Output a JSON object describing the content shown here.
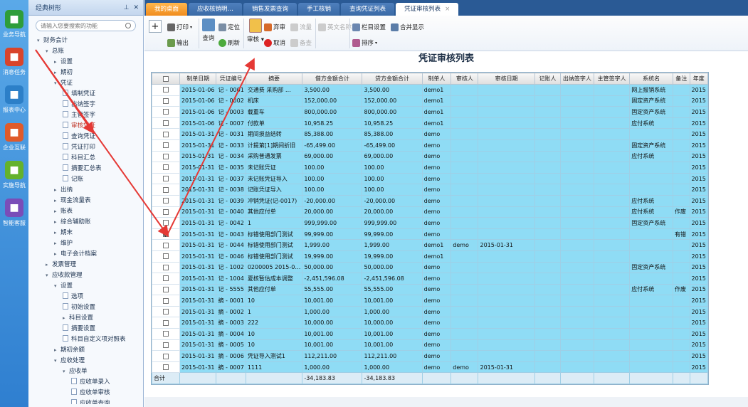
{
  "leftbar": {
    "items": [
      {
        "label": "业务导航",
        "icon": "business-nav-icon",
        "color": "#2e9d3a"
      },
      {
        "label": "消息任务",
        "icon": "message-icon",
        "color": "#d9442b"
      },
      {
        "label": "报表中心",
        "icon": "report-icon",
        "color": "#2c7fc8"
      },
      {
        "label": "企业互联",
        "icon": "enterprise-icon",
        "color": "#e05a2a"
      },
      {
        "label": "实施导航",
        "icon": "implement-icon",
        "color": "#64b22c"
      },
      {
        "label": "智能客服",
        "icon": "service-icon",
        "color": "#7a4db8"
      }
    ]
  },
  "nav": {
    "title": "经典树形",
    "search_placeholder": "请输入您要搜索的功能",
    "tree": [
      {
        "label": "财务会计",
        "level": 0,
        "arrow": "▾"
      },
      {
        "label": "总账",
        "level": 1,
        "arrow": "▾"
      },
      {
        "label": "设置",
        "level": 2,
        "arrow": "▸"
      },
      {
        "label": "期初",
        "level": 2,
        "arrow": "▸"
      },
      {
        "label": "凭证",
        "level": 2,
        "arrow": "▾"
      },
      {
        "label": "填制凭证",
        "level": 3,
        "doc": true
      },
      {
        "label": "出纳签字",
        "level": 3,
        "doc": true
      },
      {
        "label": "主管签字",
        "level": 3,
        "doc": true
      },
      {
        "label": "审核凭证",
        "level": 3,
        "doc": true,
        "selected": true
      },
      {
        "label": "查询凭证",
        "level": 3,
        "doc": true
      },
      {
        "label": "凭证打印",
        "level": 3,
        "doc": true
      },
      {
        "label": "科目汇总",
        "level": 3,
        "doc": true
      },
      {
        "label": "摘要汇总表",
        "level": 3,
        "doc": true
      },
      {
        "label": "记账",
        "level": 3,
        "doc": true
      },
      {
        "label": "出纳",
        "level": 2,
        "arrow": "▸"
      },
      {
        "label": "现金流量表",
        "level": 2,
        "arrow": "▸"
      },
      {
        "label": "账表",
        "level": 2,
        "arrow": "▸"
      },
      {
        "label": "综合辅助账",
        "level": 2,
        "arrow": "▸"
      },
      {
        "label": "期末",
        "level": 2,
        "arrow": "▸"
      },
      {
        "label": "维护",
        "level": 2,
        "arrow": "▸"
      },
      {
        "label": "电子会计档案",
        "level": 2,
        "arrow": "▸"
      },
      {
        "label": "发票管理",
        "level": 1,
        "arrow": "▸"
      },
      {
        "label": "应收款管理",
        "level": 1,
        "arrow": "▾"
      },
      {
        "label": "设置",
        "level": 2,
        "arrow": "▾"
      },
      {
        "label": "选项",
        "level": 3,
        "doc": true
      },
      {
        "label": "初始设置",
        "level": 3,
        "doc": true
      },
      {
        "label": "科目设置",
        "level": 3,
        "arrow": "▸"
      },
      {
        "label": "摘要设置",
        "level": 3,
        "doc": true
      },
      {
        "label": "科目自定义项对照表",
        "level": 3,
        "doc": true
      },
      {
        "label": "期初余额",
        "level": 2,
        "arrow": "▸"
      },
      {
        "label": "应收处理",
        "level": 2,
        "arrow": "▾"
      },
      {
        "label": "应收单",
        "level": 3,
        "arrow": "▾"
      },
      {
        "label": "应收单录入",
        "level": 4,
        "doc": true
      },
      {
        "label": "应收单审核",
        "level": 4,
        "doc": true
      },
      {
        "label": "应收单查询",
        "level": 4,
        "doc": true
      }
    ]
  },
  "tabs": [
    {
      "label": "我的桌面",
      "type": "home"
    },
    {
      "label": "应收核销明…",
      "type": "normal"
    },
    {
      "label": "销售发票查询",
      "type": "normal"
    },
    {
      "label": "手工核销",
      "type": "normal"
    },
    {
      "label": "查询凭证列表",
      "type": "normal"
    },
    {
      "label": "凭证审核列表",
      "type": "active",
      "close": "×"
    }
  ],
  "toolbar": {
    "add": "+",
    "print": "打印",
    "export": "输出",
    "query": "查询",
    "locate": "定位",
    "refresh": "刷新",
    "audit": "审核",
    "abandon": "弃审",
    "cancel": "取消",
    "flow": "流量",
    "check": "备查",
    "en_name": "英文名称",
    "column_settings": "栏目设置",
    "sort": "排序",
    "merge_display": "合并显示"
  },
  "page_title": "凭证审核列表",
  "grid": {
    "columns": [
      "制单日期",
      "凭证编号",
      "摘要",
      "借方金额合计",
      "贷方金额合计",
      "制单人",
      "审核人",
      "审核日期",
      "记账人",
      "出纳签字人",
      "主管签字人",
      "系统名",
      "备注",
      "年度"
    ],
    "rows": [
      {
        "checked": false,
        "cells": [
          "2015-01-06",
          "记 - 0001",
          "交通费 采购部 …",
          "3,500.00",
          "3,500.00",
          "demo1",
          "",
          "",
          "",
          "",
          "",
          "网上报销系统",
          "",
          "2015"
        ]
      },
      {
        "checked": false,
        "cells": [
          "2015-01-06",
          "记 - 0002",
          "机床",
          "152,000.00",
          "152,000.00",
          "demo1",
          "",
          "",
          "",
          "",
          "",
          "固定资产系统",
          "",
          "2015"
        ]
      },
      {
        "checked": false,
        "cells": [
          "2015-01-06",
          "记 - 0003",
          "载重车",
          "800,000.00",
          "800,000.00",
          "demo1",
          "",
          "",
          "",
          "",
          "",
          "固定资产系统",
          "",
          "2015"
        ]
      },
      {
        "checked": false,
        "cells": [
          "2015-01-06",
          "记 - 0007",
          "付款单",
          "10,958.25",
          "10,958.25",
          "demo1",
          "",
          "",
          "",
          "",
          "",
          "应付系统",
          "",
          "2015"
        ]
      },
      {
        "checked": false,
        "cells": [
          "2015-01-31",
          "记 - 0031",
          "期间损益结转",
          "85,388.00",
          "85,388.00",
          "demo",
          "",
          "",
          "",
          "",
          "",
          "",
          "",
          "2015"
        ]
      },
      {
        "checked": false,
        "cells": [
          "2015-01-31",
          "记 - 0033",
          "计提第[1]期间折旧",
          "-65,499.00",
          "-65,499.00",
          "demo",
          "",
          "",
          "",
          "",
          "",
          "固定资产系统",
          "",
          "2015"
        ]
      },
      {
        "checked": false,
        "cells": [
          "2015-01-31",
          "记 - 0034",
          "采购普通发票",
          "69,000.00",
          "69,000.00",
          "demo",
          "",
          "",
          "",
          "",
          "",
          "应付系统",
          "",
          "2015"
        ]
      },
      {
        "checked": false,
        "cells": [
          "2015-01-31",
          "记 - 0035",
          "未记账凭证",
          "100.00",
          "100.00",
          "demo",
          "",
          "",
          "",
          "",
          "",
          "",
          "",
          "2015"
        ]
      },
      {
        "checked": false,
        "cells": [
          "2015-01-31",
          "记 - 0037",
          "未记账凭证导入",
          "100.00",
          "100.00",
          "demo",
          "",
          "",
          "",
          "",
          "",
          "",
          "",
          "2015"
        ]
      },
      {
        "checked": false,
        "cells": [
          "2015-01-31",
          "记 - 0038",
          "记账凭证导入",
          "100.00",
          "100.00",
          "demo",
          "",
          "",
          "",
          "",
          "",
          "",
          "",
          "2015"
        ]
      },
      {
        "checked": false,
        "cells": [
          "2015-01-31",
          "记 - 0039",
          "冲销凭证(记-0017)",
          "-20,000.00",
          "-20,000.00",
          "demo",
          "",
          "",
          "",
          "",
          "",
          "应付系统",
          "",
          "2015"
        ]
      },
      {
        "checked": false,
        "cells": [
          "2015-01-31",
          "记 - 0040",
          "其他应付单",
          "20,000.00",
          "20,000.00",
          "demo",
          "",
          "",
          "",
          "",
          "",
          "应付系统",
          "作废",
          "2015"
        ]
      },
      {
        "checked": false,
        "cells": [
          "2015-01-31",
          "记 - 0042",
          "1",
          "999,999.00",
          "999,999.00",
          "demo",
          "",
          "",
          "",
          "",
          "",
          "固定资产系统",
          "",
          "2015"
        ]
      },
      {
        "checked": true,
        "cells": [
          "2015-01-31",
          "记 - 0043",
          "标错使用部门测试",
          "99,999.00",
          "99,999.00",
          "demo",
          "",
          "",
          "",
          "",
          "",
          "",
          "有错",
          "2015"
        ]
      },
      {
        "checked": false,
        "cells": [
          "2015-01-31",
          "记 - 0044",
          "标错使用部门测试",
          "1,999.00",
          "1,999.00",
          "demo1",
          "demo",
          "2015-01-31",
          "",
          "",
          "",
          "",
          "",
          "2015"
        ]
      },
      {
        "checked": false,
        "cells": [
          "2015-01-31",
          "记 - 0046",
          "标错使用部门测试",
          "19,999.00",
          "19,999.00",
          "demo1",
          "",
          "",
          "",
          "",
          "",
          "",
          "",
          "2015"
        ]
      },
      {
        "checked": false,
        "cells": [
          "2015-01-31",
          "记 - 1002",
          "0200005 2015-0…",
          "50,000.00",
          "50,000.00",
          "demo",
          "",
          "",
          "",
          "",
          "",
          "固定资产系统",
          "",
          "2015"
        ]
      },
      {
        "checked": false,
        "cells": [
          "2015-01-31",
          "记 - 1004",
          "夏核暂估成本调整",
          "-2,451,596.08",
          "-2,451,596.08",
          "demo",
          "",
          "",
          "",
          "",
          "",
          "",
          "",
          "2015"
        ]
      },
      {
        "checked": false,
        "cells": [
          "2015-01-31",
          "记 - 5555",
          "其他应付单",
          "55,555.00",
          "55,555.00",
          "demo",
          "",
          "",
          "",
          "",
          "",
          "应付系统",
          "作废",
          "2015"
        ]
      },
      {
        "checked": false,
        "cells": [
          "2015-01-31",
          "摘 - 0001",
          "10",
          "10,001.00",
          "10,001.00",
          "demo",
          "",
          "",
          "",
          "",
          "",
          "",
          "",
          "2015"
        ]
      },
      {
        "checked": false,
        "cells": [
          "2015-01-31",
          "摘 - 0002",
          "1",
          "1,000.00",
          "1,000.00",
          "demo",
          "",
          "",
          "",
          "",
          "",
          "",
          "",
          "2015"
        ]
      },
      {
        "checked": false,
        "cells": [
          "2015-01-31",
          "摘 - 0003",
          "222",
          "10,000.00",
          "10,000.00",
          "demo",
          "",
          "",
          "",
          "",
          "",
          "",
          "",
          "2015"
        ]
      },
      {
        "checked": false,
        "cells": [
          "2015-01-31",
          "摘 - 0004",
          "10",
          "10,001.00",
          "10,001.00",
          "demo",
          "",
          "",
          "",
          "",
          "",
          "",
          "",
          "2015"
        ]
      },
      {
        "checked": false,
        "cells": [
          "2015-01-31",
          "摘 - 0005",
          "10",
          "10,001.00",
          "10,001.00",
          "demo",
          "",
          "",
          "",
          "",
          "",
          "",
          "",
          "2015"
        ]
      },
      {
        "checked": false,
        "cells": [
          "2015-01-31",
          "摘 - 0006",
          "凭证导入测试1",
          "112,211.00",
          "112,211.00",
          "demo",
          "",
          "",
          "",
          "",
          "",
          "",
          "",
          "2015"
        ]
      },
      {
        "checked": false,
        "cells": [
          "2015-01-31",
          "摘 - 0007",
          "1111",
          "1,000.00",
          "1,000.00",
          "demo",
          "demo",
          "2015-01-31",
          "",
          "",
          "",
          "",
          "",
          "2015"
        ]
      }
    ],
    "total": {
      "label": "合计",
      "debit": "-34,183.83",
      "credit": "-34,183.83"
    }
  }
}
